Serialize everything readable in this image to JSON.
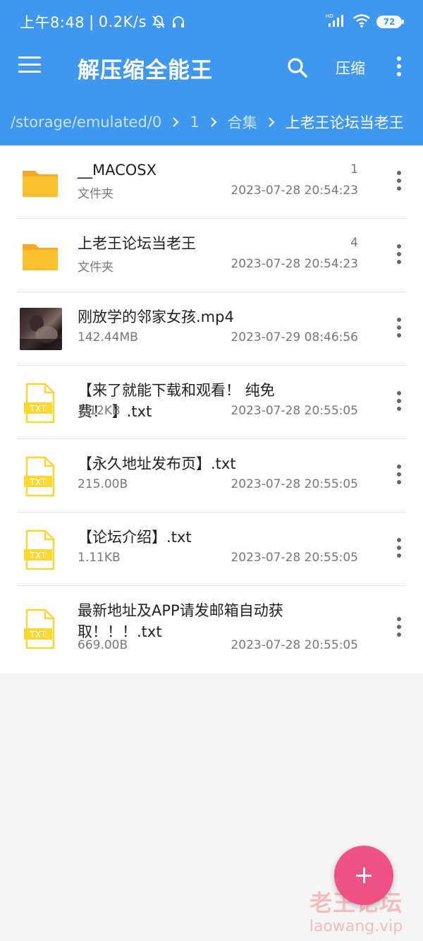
{
  "status_bar": {
    "time": "上午8:48",
    "network_speed": "0.2K/s",
    "icons": [
      "mute-bell-icon",
      "headset-icon",
      "hd-signal-icon",
      "wifi-icon"
    ],
    "battery": "72"
  },
  "toolbar": {
    "menu_icon": "hamburger-menu-icon",
    "title": "解压缩全能王",
    "search_icon": "search-icon",
    "compress_label": "压缩",
    "more_icon": "more-vert-icon"
  },
  "breadcrumb": [
    "/storage/emulated/0",
    "1",
    "合集",
    "上老王论坛当老王"
  ],
  "files": [
    {
      "name": "__MACOSX",
      "sub": "文件夹",
      "count": "1",
      "date": "2023-07-28 20:54:23",
      "icon": "folder-icon"
    },
    {
      "name": "上老王论坛当老王",
      "sub": "文件夹",
      "count": "4",
      "date": "2023-07-28 20:54:23",
      "icon": "folder-icon"
    },
    {
      "name": "刚放学的邻家女孩.mp4",
      "sub": "142.44MB",
      "count": "",
      "date": "2023-07-29 08:46:56",
      "icon": "video-thumbnail"
    },
    {
      "name": "【来了就能下载和观看！ 纯免费！ 】.txt",
      "sub": "1.12KB",
      "count": "",
      "date": "2023-07-28 20:55:05",
      "icon": "txt-file-icon"
    },
    {
      "name": "【永久地址发布页】.txt",
      "sub": "215.00B",
      "count": "",
      "date": "2023-07-28 20:55:05",
      "icon": "txt-file-icon"
    },
    {
      "name": "【论坛介绍】.txt",
      "sub": "1.11KB",
      "count": "",
      "date": "2023-07-28 20:55:05",
      "icon": "txt-file-icon"
    },
    {
      "name": "最新地址及APP请发邮箱自动获取！！！.txt",
      "sub": "669.00B",
      "count": "",
      "date": "2023-07-28 20:55:05",
      "icon": "txt-file-icon"
    }
  ],
  "txt_label": "TXT",
  "fab_icon": "plus-icon",
  "watermark": {
    "cn": "老王论坛",
    "en": "laowang.vip"
  },
  "colors": {
    "header": "#3f97ee",
    "folder": "#fbc02d",
    "txt_icon": "#fdd835",
    "fab": "#f05287",
    "background": "#f5f5f5"
  }
}
